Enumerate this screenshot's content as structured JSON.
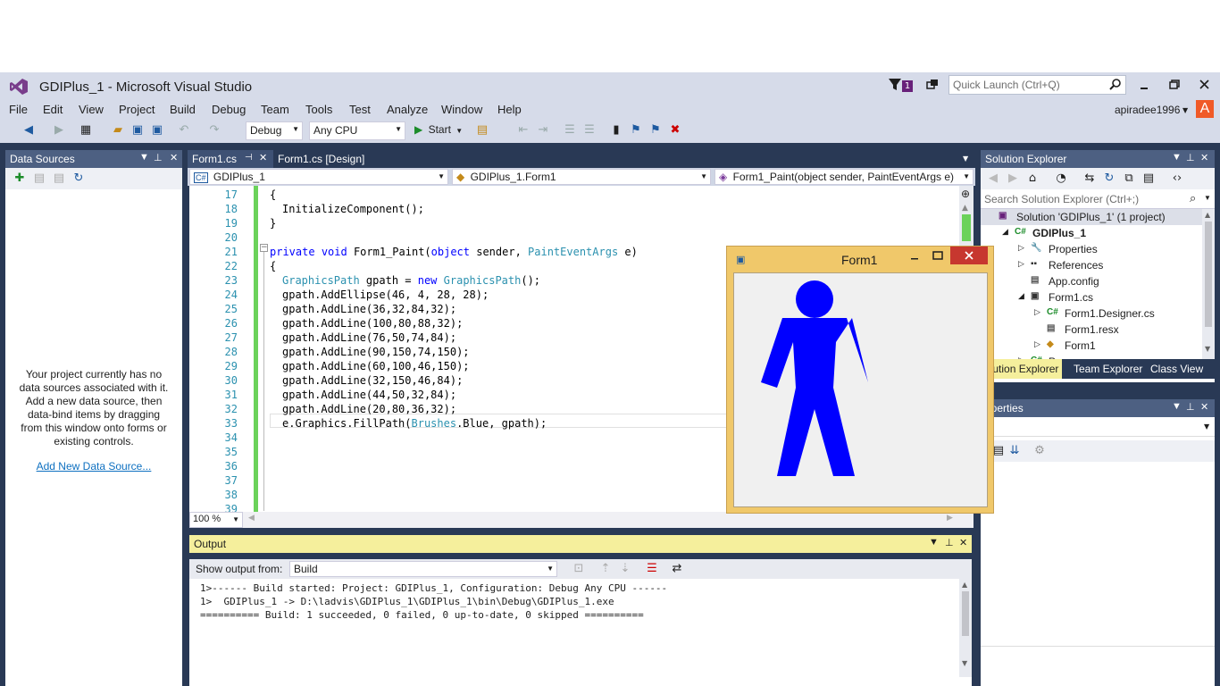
{
  "window": {
    "title": "GDIPlus_1 - Microsoft Visual Studio",
    "notifications_count": "1",
    "quick_launch_placeholder": "Quick Launch (Ctrl+Q)",
    "user": "apiradee1996",
    "avatar_letter": "A"
  },
  "menu": [
    "File",
    "Edit",
    "View",
    "Project",
    "Build",
    "Debug",
    "Team",
    "Tools",
    "Test",
    "Analyze",
    "Window",
    "Help"
  ],
  "toolbar": {
    "config": "Debug",
    "platform": "Any CPU",
    "start_label": "Start"
  },
  "data_sources": {
    "title": "Data Sources",
    "message": "Your project currently has no data sources associated with it. Add a new data source, then data-bind items by dragging from this window onto forms or existing controls.",
    "link": "Add New Data Source..."
  },
  "editor": {
    "tabs": [
      "Form1.cs",
      "Form1.cs [Design]"
    ],
    "nav": [
      "GDIPlus_1",
      "GDIPlus_1.Form1",
      "Form1_Paint(object sender, PaintEventArgs e)"
    ],
    "zoom": "100 %",
    "lines": [
      {
        "n": "17",
        "indent": 2,
        "text": "{"
      },
      {
        "n": "18",
        "indent": 3,
        "text": "InitializeComponent();"
      },
      {
        "n": "19",
        "indent": 2,
        "text": "}"
      },
      {
        "n": "20",
        "indent": 0,
        "text": ""
      },
      {
        "n": "21",
        "indent": 2,
        "text": "private void Form1_Paint(object sender, PaintEventArgs e)"
      },
      {
        "n": "22",
        "indent": 2,
        "text": "{"
      },
      {
        "n": "23",
        "indent": 3,
        "text": "GraphicsPath gpath = new GraphicsPath();"
      },
      {
        "n": "24",
        "indent": 3,
        "text": "gpath.AddEllipse(46, 4, 28, 28);"
      },
      {
        "n": "25",
        "indent": 3,
        "text": "gpath.AddLine(36,32,84,32);"
      },
      {
        "n": "26",
        "indent": 3,
        "text": "gpath.AddLine(100,80,88,32);"
      },
      {
        "n": "27",
        "indent": 3,
        "text": "gpath.AddLine(76,50,74,84);"
      },
      {
        "n": "28",
        "indent": 3,
        "text": "gpath.AddLine(90,150,74,150);"
      },
      {
        "n": "29",
        "indent": 3,
        "text": "gpath.AddLine(60,100,46,150);"
      },
      {
        "n": "30",
        "indent": 3,
        "text": "gpath.AddLine(32,150,46,84);"
      },
      {
        "n": "31",
        "indent": 3,
        "text": "gpath.AddLine(44,50,32,84);"
      },
      {
        "n": "32",
        "indent": 3,
        "text": "gpath.AddLine(20,80,36,32);"
      },
      {
        "n": "33",
        "indent": 3,
        "text": "e.Graphics.FillPath(Brushes.Blue, gpath);"
      },
      {
        "n": "34",
        "indent": 0,
        "text": ""
      },
      {
        "n": "35",
        "indent": 0,
        "text": ""
      },
      {
        "n": "36",
        "indent": 0,
        "text": ""
      },
      {
        "n": "37",
        "indent": 0,
        "text": ""
      },
      {
        "n": "38",
        "indent": 0,
        "text": ""
      },
      {
        "n": "39",
        "indent": 0,
        "text": ""
      }
    ]
  },
  "output": {
    "title": "Output",
    "show_from_label": "Show output from:",
    "source": "Build",
    "lines": [
      "1>------ Build started: Project: GDIPlus_1, Configuration: Debug Any CPU ------",
      "1>  GDIPlus_1 -> D:\\ladvis\\GDIPlus_1\\GDIPlus_1\\bin\\Debug\\GDIPlus_1.exe",
      "========== Build: 1 succeeded, 0 failed, 0 up-to-date, 0 skipped =========="
    ]
  },
  "solution_explorer": {
    "title": "Solution Explorer",
    "search_placeholder": "Search Solution Explorer (Ctrl+;)",
    "items": [
      {
        "label": "Solution 'GDIPlus_1' (1 project)",
        "level": 0,
        "arrow": "",
        "icon": "solution-icon"
      },
      {
        "label": "GDIPlus_1",
        "level": 1,
        "arrow": "◢",
        "icon": "csharp-project-icon"
      },
      {
        "label": "Properties",
        "level": 2,
        "arrow": "▷",
        "icon": "wrench-icon"
      },
      {
        "label": "References",
        "level": 2,
        "arrow": "▷",
        "icon": "references-icon"
      },
      {
        "label": "App.config",
        "level": 2,
        "arrow": "",
        "icon": "config-file-icon"
      },
      {
        "label": "Form1.cs",
        "level": 2,
        "arrow": "◢",
        "icon": "form-icon"
      },
      {
        "label": "Form1.Designer.cs",
        "level": 3,
        "arrow": "▷",
        "icon": "cs-file-icon"
      },
      {
        "label": "Form1.resx",
        "level": 3,
        "arrow": "",
        "icon": "resx-file-icon"
      },
      {
        "label": "Form1",
        "level": 3,
        "arrow": "▷",
        "icon": "class-icon"
      },
      {
        "label": "Program.cs",
        "level": 2,
        "arrow": "▷",
        "icon": "cs-file-icon"
      }
    ],
    "tabs": [
      "olution Explorer",
      "Team Explorer",
      "Class View"
    ]
  },
  "properties": {
    "title": "operties"
  },
  "form1": {
    "title": "Form1"
  },
  "colors": {
    "figure_fill": "#0000ff",
    "vs_accent": "#293955",
    "form_frame": "#f0c86a"
  }
}
